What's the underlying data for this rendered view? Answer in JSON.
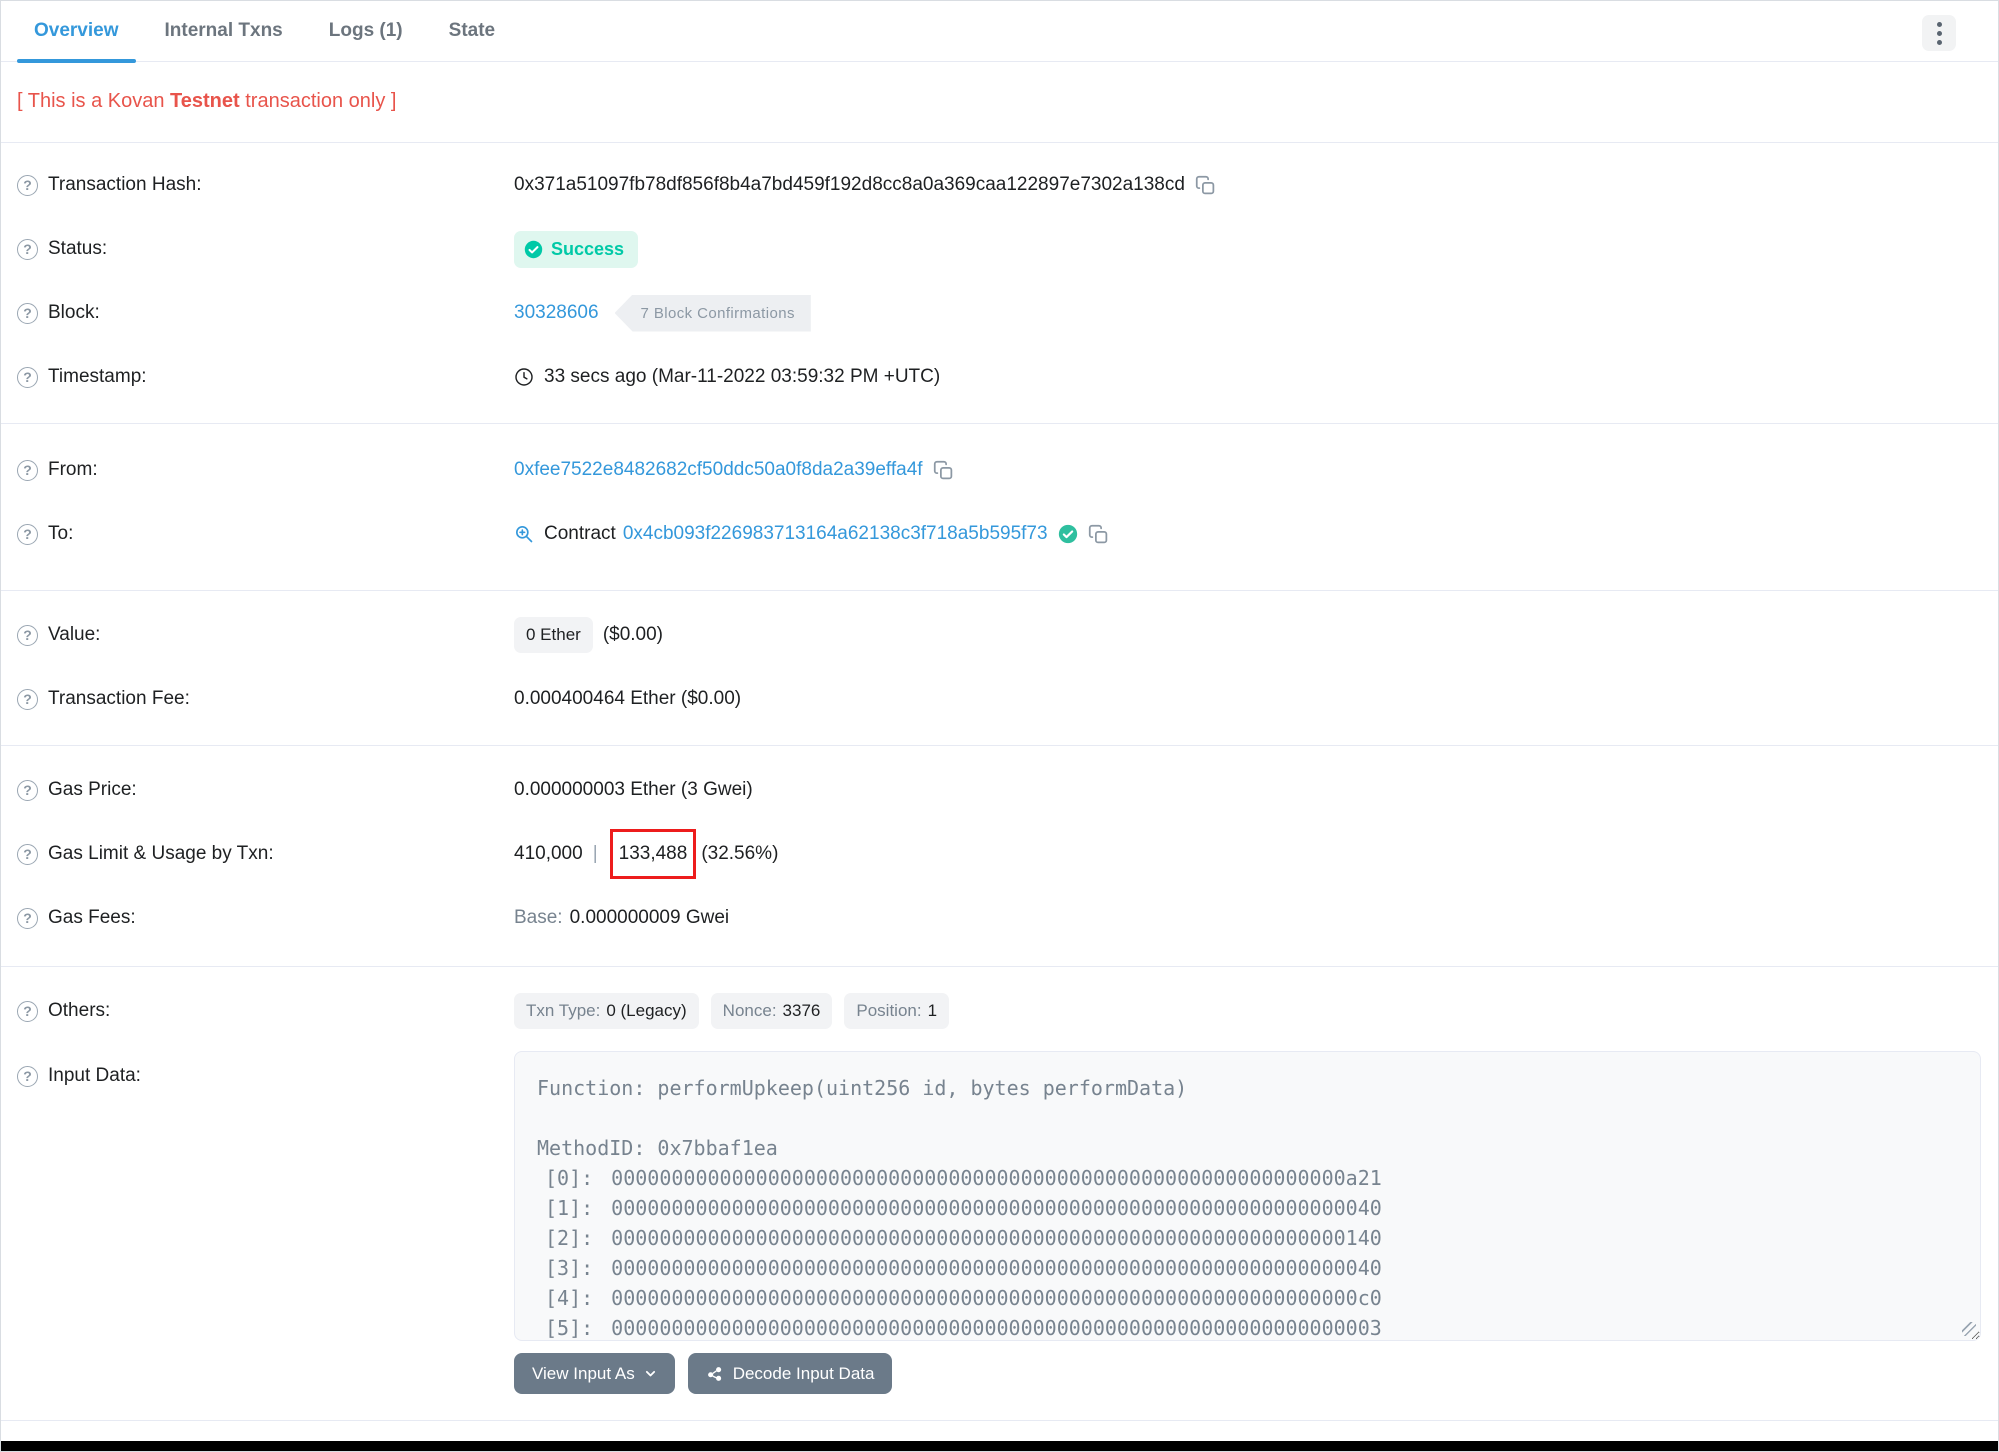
{
  "tabs": {
    "items": [
      {
        "label": "Overview",
        "active": true
      },
      {
        "label": "Internal Txns",
        "active": false
      },
      {
        "label": "Logs (1)",
        "active": false
      },
      {
        "label": "State",
        "active": false
      }
    ]
  },
  "notice": {
    "part1": "[ This is a Kovan ",
    "bold": "Testnet",
    "part2": " transaction only ]"
  },
  "rows": {
    "transaction_hash": {
      "label": "Transaction Hash:",
      "value": "0x371a51097fb78df856f8b4a7bd459f192d8cc8a0a369caa122897e7302a138cd"
    },
    "status": {
      "label": "Status:",
      "value": "Success"
    },
    "block": {
      "label": "Block:",
      "number": "30328606",
      "confirmations": "7 Block Confirmations"
    },
    "timestamp": {
      "label": "Timestamp:",
      "value": "33 secs ago (Mar-11-2022 03:59:32 PM +UTC)"
    },
    "from": {
      "label": "From:",
      "address": "0xfee7522e8482682cf50ddc50a0f8da2a39effa4f"
    },
    "to": {
      "label": "To:",
      "prefix": "Contract",
      "address": "0x4cb093f226983713164a62138c3f718a5b595f73"
    },
    "value": {
      "label": "Value:",
      "badge": "0 Ether",
      "usd": "($0.00)"
    },
    "transaction_fee": {
      "label": "Transaction Fee:",
      "value": "0.000400464 Ether ($0.00)"
    },
    "gas_price": {
      "label": "Gas Price:",
      "value": "0.000000003 Ether (3 Gwei)"
    },
    "gas_limit": {
      "label": "Gas Limit & Usage by Txn:",
      "limit": "410,000",
      "separator": "|",
      "used": "133,488",
      "percent": "(32.56%)"
    },
    "gas_fees": {
      "label": "Gas Fees:",
      "base_label": "Base:",
      "base_value": "0.000000009 Gwei"
    },
    "others": {
      "label": "Others:",
      "badges": [
        {
          "label": "Txn Type:",
          "value": "0 (Legacy)"
        },
        {
          "label": "Nonce:",
          "value": "3376"
        },
        {
          "label": "Position:",
          "value": "1"
        }
      ]
    },
    "input_data": {
      "label": "Input Data:",
      "function_line": "Function: performUpkeep(uint256 id, bytes performData)",
      "method_id": "MethodID: 0x7bbaf1ea",
      "words": [
        {
          "index": "[0]:",
          "hex": "0000000000000000000000000000000000000000000000000000000000000a21"
        },
        {
          "index": "[1]:",
          "hex": "0000000000000000000000000000000000000000000000000000000000000040"
        },
        {
          "index": "[2]:",
          "hex": "0000000000000000000000000000000000000000000000000000000000000140"
        },
        {
          "index": "[3]:",
          "hex": "0000000000000000000000000000000000000000000000000000000000000040"
        },
        {
          "index": "[4]:",
          "hex": "00000000000000000000000000000000000000000000000000000000000000c0"
        },
        {
          "index": "[5]:",
          "hex": "0000000000000000000000000000000000000000000000000000000000000003"
        }
      ]
    }
  },
  "buttons": {
    "view_input_as": "View Input As",
    "decode": "Decode Input Data"
  },
  "colors": {
    "accent_blue": "#3498db",
    "success_teal": "#00c9a7",
    "notice_red": "#e8544b",
    "highlight_box_red": "#ed1c1c",
    "divider": "#e7eaf3",
    "button_slate": "#6b7a89"
  }
}
